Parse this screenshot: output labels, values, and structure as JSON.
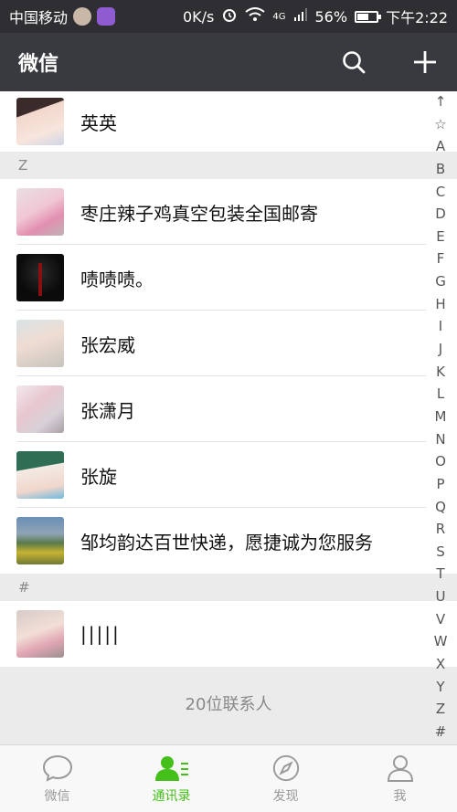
{
  "status_bar": {
    "carrier": "中国移动",
    "speed": "0K/s",
    "network": "4G",
    "battery": "56%",
    "time": "下午2:22"
  },
  "header": {
    "title": "微信",
    "search_icon": "search-icon",
    "add_icon": "plus-icon"
  },
  "contacts": [
    {
      "name": "英英"
    },
    {
      "section": "Z"
    },
    {
      "name": "枣庄辣子鸡真空包装全国邮寄"
    },
    {
      "name": "啧啧啧。"
    },
    {
      "name": "张宏威"
    },
    {
      "name": "张潇月"
    },
    {
      "name": "张旋"
    },
    {
      "name": "邹均韵达百世快递，愿捷诚为您服务"
    },
    {
      "section": "#"
    },
    {
      "name": "|||||"
    }
  ],
  "footer_count": "20位联系人",
  "index": [
    "↑",
    "☆",
    "A",
    "B",
    "C",
    "D",
    "E",
    "F",
    "G",
    "H",
    "I",
    "J",
    "K",
    "L",
    "M",
    "N",
    "O",
    "P",
    "Q",
    "R",
    "S",
    "T",
    "U",
    "V",
    "W",
    "X",
    "Y",
    "Z",
    "#"
  ],
  "tabs": [
    {
      "label": "微信",
      "icon": "chat-bubble-icon",
      "active": false
    },
    {
      "label": "通讯录",
      "icon": "contacts-icon",
      "active": true
    },
    {
      "label": "发现",
      "icon": "compass-icon",
      "active": false
    },
    {
      "label": "我",
      "icon": "person-icon",
      "active": false
    }
  ],
  "colors": {
    "accent": "#45c01a",
    "header_bg": "#393a3f",
    "status_bg": "#2f2f33"
  }
}
